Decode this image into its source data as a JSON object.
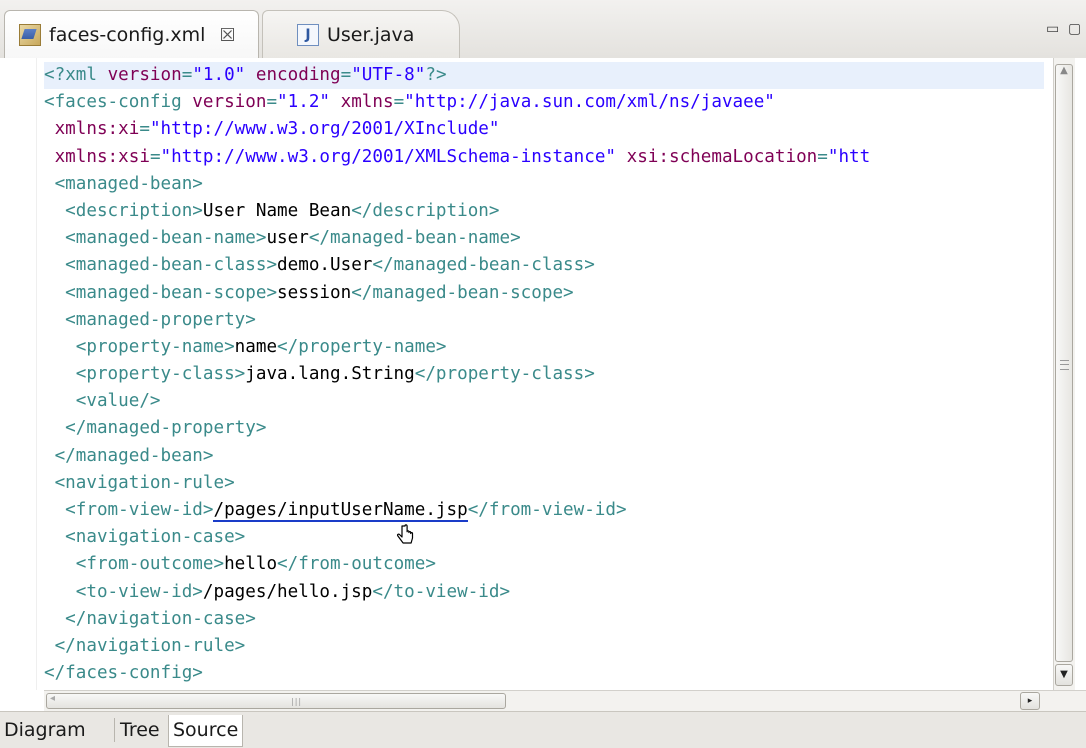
{
  "tabs": [
    {
      "label": "faces-config.xml",
      "icon": "xml-file-icon",
      "close": "☒",
      "active": true
    },
    {
      "label": "User.java",
      "icon": "java-file-icon",
      "active": false
    }
  ],
  "editor": {
    "lines": [
      [
        [
          "t",
          "<?"
        ],
        [
          "t",
          "xml "
        ],
        [
          "a",
          "version"
        ],
        [
          "t",
          "="
        ],
        [
          "v",
          "\"1.0\""
        ],
        [
          "t",
          " "
        ],
        [
          "a",
          "encoding"
        ],
        [
          "t",
          "="
        ],
        [
          "v",
          "\"UTF-8\""
        ],
        [
          "t",
          "?>"
        ]
      ],
      [
        [
          "t",
          "<faces-config "
        ],
        [
          "a",
          "version"
        ],
        [
          "t",
          "="
        ],
        [
          "v",
          "\"1.2\""
        ],
        [
          "t",
          " "
        ],
        [
          "a",
          "xmlns"
        ],
        [
          "t",
          "="
        ],
        [
          "v",
          "\"http://java.sun.com/xml/ns/javaee\""
        ]
      ],
      [
        [
          "t",
          " "
        ],
        [
          "a",
          "xmlns:xi"
        ],
        [
          "t",
          "="
        ],
        [
          "v",
          "\"http://www.w3.org/2001/XInclude\""
        ]
      ],
      [
        [
          "t",
          " "
        ],
        [
          "a",
          "xmlns:xsi"
        ],
        [
          "t",
          "="
        ],
        [
          "v",
          "\"http://www.w3.org/2001/XMLSchema-instance\""
        ],
        [
          "t",
          " "
        ],
        [
          "a",
          "xsi:schemaLocation"
        ],
        [
          "t",
          "="
        ],
        [
          "v",
          "\"htt"
        ]
      ],
      [
        [
          "t",
          " <managed-bean>"
        ]
      ],
      [
        [
          "t",
          "  <description>"
        ],
        [
          "x",
          "User Name Bean"
        ],
        [
          "t",
          "</description>"
        ]
      ],
      [
        [
          "t",
          "  <managed-bean-name>"
        ],
        [
          "x",
          "user"
        ],
        [
          "t",
          "</managed-bean-name>"
        ]
      ],
      [
        [
          "t",
          "  <managed-bean-class>"
        ],
        [
          "x",
          "demo.User"
        ],
        [
          "t",
          "</managed-bean-class>"
        ]
      ],
      [
        [
          "t",
          "  <managed-bean-scope>"
        ],
        [
          "x",
          "session"
        ],
        [
          "t",
          "</managed-bean-scope>"
        ]
      ],
      [
        [
          "t",
          "  <managed-property>"
        ]
      ],
      [
        [
          "t",
          "   <property-name>"
        ],
        [
          "x",
          "name"
        ],
        [
          "t",
          "</property-name>"
        ]
      ],
      [
        [
          "t",
          "   <property-class>"
        ],
        [
          "x",
          "java.lang.String"
        ],
        [
          "t",
          "</property-class>"
        ]
      ],
      [
        [
          "t",
          "   <value/>"
        ]
      ],
      [
        [
          "t",
          "  </managed-property>"
        ]
      ],
      [
        [
          "t",
          " </managed-bean>"
        ]
      ],
      [
        [
          "t",
          " <navigation-rule>"
        ]
      ],
      [
        [
          "t",
          "  <from-view-id>"
        ],
        [
          "link",
          "/pages/inputUserName.jsp"
        ],
        [
          "t",
          "</from-view-id>"
        ]
      ],
      [
        [
          "t",
          "  <navigation-case>"
        ]
      ],
      [
        [
          "t",
          "   <from-outcome>"
        ],
        [
          "x",
          "hello"
        ],
        [
          "t",
          "</from-outcome>"
        ]
      ],
      [
        [
          "t",
          "   <to-view-id>"
        ],
        [
          "x",
          "/pages/hello.jsp"
        ],
        [
          "t",
          "</to-view-id>"
        ]
      ],
      [
        [
          "t",
          "  </navigation-case>"
        ]
      ],
      [
        [
          "t",
          " </navigation-rule>"
        ]
      ],
      [
        [
          "t",
          "</faces-config>"
        ]
      ]
    ]
  },
  "bottom_tabs": [
    {
      "label": "Diagram",
      "selected": false
    },
    {
      "label": "Tree",
      "selected": false
    },
    {
      "label": "Source",
      "selected": true
    }
  ],
  "scrollbar": {
    "up_arrow": "▲",
    "down_arrow": "▼",
    "left_arrow": "◂",
    "right_arrow": "▸",
    "grip": "|||"
  },
  "window_controls": {
    "minimize": "▭",
    "maximize": "▢"
  }
}
